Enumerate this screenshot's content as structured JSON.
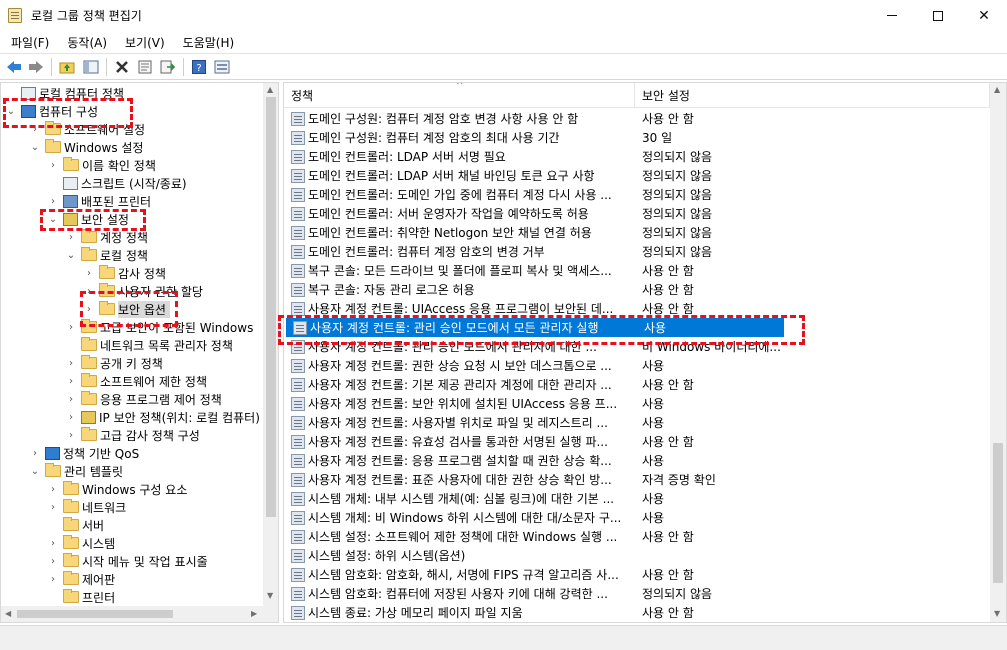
{
  "window": {
    "title": "로컬 그룹 정책 편집기",
    "min_glyph": "",
    "close_glyph": "✕"
  },
  "menu": [
    "파일(F)",
    "동작(A)",
    "보기(V)",
    "도움말(H)"
  ],
  "toolbar": {
    "icons": [
      "back-arrow-icon",
      "forward-arrow-icon",
      "up-folder-icon",
      "show-hide-tree-icon",
      "delete-icon",
      "properties-icon",
      "export-list-icon",
      "help-icon",
      "view-icon"
    ]
  },
  "tree": [
    {
      "label": "로컬 컴퓨터 정책",
      "icon": "policy-doc-icon",
      "expander": ""
    },
    {
      "label": "컴퓨터 구성",
      "icon": "computer-icon",
      "expander": "⌄"
    },
    {
      "label": "소프트웨어 설정",
      "icon": "folder-icon",
      "expander": "›"
    },
    {
      "label": "Windows 설정",
      "icon": "folder-icon",
      "expander": "⌄"
    },
    {
      "label": "이름 확인 정책",
      "icon": "folder-icon",
      "expander": "›"
    },
    {
      "label": "스크립트 (시작/종료)",
      "icon": "script-icon",
      "expander": ""
    },
    {
      "label": "배포된 프린터",
      "icon": "printer-icon",
      "expander": "›"
    },
    {
      "label": "보안 설정",
      "icon": "security-icon",
      "expander": "⌄"
    },
    {
      "label": "계정 정책",
      "icon": "folder-icon",
      "expander": "›"
    },
    {
      "label": "로컬 정책",
      "icon": "folder-icon",
      "expander": "⌄"
    },
    {
      "label": "감사 정책",
      "icon": "folder-icon",
      "expander": "›"
    },
    {
      "label": "사용자 권한 할당",
      "icon": "folder-icon",
      "expander": "›"
    },
    {
      "label": "보안 옵션",
      "icon": "folder-icon",
      "expander": "›"
    },
    {
      "label": "고급 보안이 포함된 Windows",
      "icon": "folder-icon",
      "expander": "›"
    },
    {
      "label": "네트워크 목록 관리자 정책",
      "icon": "folder-icon",
      "expander": ""
    },
    {
      "label": "공개 키 정책",
      "icon": "folder-icon",
      "expander": "›"
    },
    {
      "label": "소프트웨어 제한 정책",
      "icon": "folder-icon",
      "expander": "›"
    },
    {
      "label": "응용 프로그램 제어 정책",
      "icon": "folder-icon",
      "expander": "›"
    },
    {
      "label": "IP 보안 정책(위치: 로컬 컴퓨터)",
      "icon": "ip-security-icon",
      "expander": "›"
    },
    {
      "label": "고급 감사 정책 구성",
      "icon": "folder-icon",
      "expander": "›"
    },
    {
      "label": "정책 기반 QoS",
      "icon": "chart-icon",
      "expander": "›"
    },
    {
      "label": "관리 템플릿",
      "icon": "folder-icon",
      "expander": "⌄"
    },
    {
      "label": "Windows 구성 요소",
      "icon": "folder-icon",
      "expander": "›"
    },
    {
      "label": "네트워크",
      "icon": "folder-icon",
      "expander": "›"
    },
    {
      "label": "서버",
      "icon": "folder-icon",
      "expander": ""
    },
    {
      "label": "시스템",
      "icon": "folder-icon",
      "expander": "›"
    },
    {
      "label": "시작 메뉴 및 작업 표시줄",
      "icon": "folder-icon",
      "expander": "›"
    },
    {
      "label": "제어판",
      "icon": "folder-icon",
      "expander": "›"
    },
    {
      "label": "프린터",
      "icon": "folder-icon",
      "expander": ""
    }
  ],
  "list": {
    "columns": [
      "정책",
      "보안 설정"
    ],
    "sort_glyph": "^",
    "rows": [
      {
        "policy": "도메인 구성원: 컴퓨터 계정 암호 변경 사항 사용 안 함",
        "setting": "사용 안 함"
      },
      {
        "policy": "도메인 구성원: 컴퓨터 계정 암호의 최대 사용 기간",
        "setting": "30 일"
      },
      {
        "policy": "도메인 컨트롤러: LDAP 서버 서명 필요",
        "setting": "정의되지 않음"
      },
      {
        "policy": "도메인 컨트롤러: LDAP 서버 채널 바인딩 토큰 요구 사항",
        "setting": "정의되지 않음"
      },
      {
        "policy": "도메인 컨트롤러: 도메인 가입 중에 컴퓨터 계정 다시 사용 ...",
        "setting": "정의되지 않음"
      },
      {
        "policy": "도메인 컨트롤러: 서버 운영자가 작업을 예약하도록 허용",
        "setting": "정의되지 않음"
      },
      {
        "policy": "도메인 컨트롤러: 취약한 Netlogon 보안 채널 연결 허용",
        "setting": "정의되지 않음"
      },
      {
        "policy": "도메인 컨트롤러: 컴퓨터 계정 암호의 변경 거부",
        "setting": "정의되지 않음"
      },
      {
        "policy": "복구 콘솔: 모든 드라이브 및 폴더에 플로피 복사 및 액세스...",
        "setting": "사용 안 함"
      },
      {
        "policy": "복구 콘솔: 자동 관리 로그온 허용",
        "setting": "사용 안 함"
      },
      {
        "policy": "사용자 계정 컨트롤: UIAccess 응용 프로그램이 보안된 데...",
        "setting": "사용 안 함"
      },
      {
        "policy": "사용자 계정 컨트롤: 관리 승인 모드에서 모든 관리자 실행",
        "setting": "사용"
      },
      {
        "policy": "사용자 계정 컨트롤: 관리 승인 모드에서 관리자에 대한 ...",
        "setting": "비 Windows 바이너리에..."
      },
      {
        "policy": "사용자 계정 컨트롤: 권한 상승 요청 시 보안 데스크톱으로 ...",
        "setting": "사용"
      },
      {
        "policy": "사용자 계정 컨트롤: 기본 제공 관리자 계정에 대한 관리자 ...",
        "setting": "사용 안 함"
      },
      {
        "policy": "사용자 계정 컨트롤: 보안 위치에 설치된 UIAccess 응용 프...",
        "setting": "사용"
      },
      {
        "policy": "사용자 계정 컨트롤: 사용자별 위치로 파일 및 레지스트리 ...",
        "setting": "사용"
      },
      {
        "policy": "사용자 계정 컨트롤: 유효성 검사를 통과한 서명된 실행 파...",
        "setting": "사용 안 함"
      },
      {
        "policy": "사용자 계정 컨트롤: 응용 프로그램 설치할 때 권한 상승 확...",
        "setting": "사용"
      },
      {
        "policy": "사용자 계정 컨트롤: 표준 사용자에 대한 권한 상승 확인 방...",
        "setting": "자격 증명 확인"
      },
      {
        "policy": "시스템 개체: 내부 시스템 개체(예: 심볼 링크)에 대한 기본 ...",
        "setting": "사용"
      },
      {
        "policy": "시스템 개체: 비 Windows 하위 시스템에 대한 대/소문자 구...",
        "setting": "사용"
      },
      {
        "policy": "시스템 설정: 소프트웨어 제한 정책에 대한 Windows 실행 ...",
        "setting": "사용 안 함"
      },
      {
        "policy": "시스템 설정: 하위 시스템(옵션)",
        "setting": ""
      },
      {
        "policy": "시스템 암호화: 암호화, 해시, 서명에 FIPS 규격 알고리즘 사...",
        "setting": "사용 안 함"
      },
      {
        "policy": "시스템 암호화: 컴퓨터에 저장된 사용자 키에 대해 강력한 ...",
        "setting": "정의되지 않음"
      },
      {
        "policy": "시스템 종료: 가상 메모리 페이지 파일 지움",
        "setting": "사용 안 함"
      }
    ]
  }
}
